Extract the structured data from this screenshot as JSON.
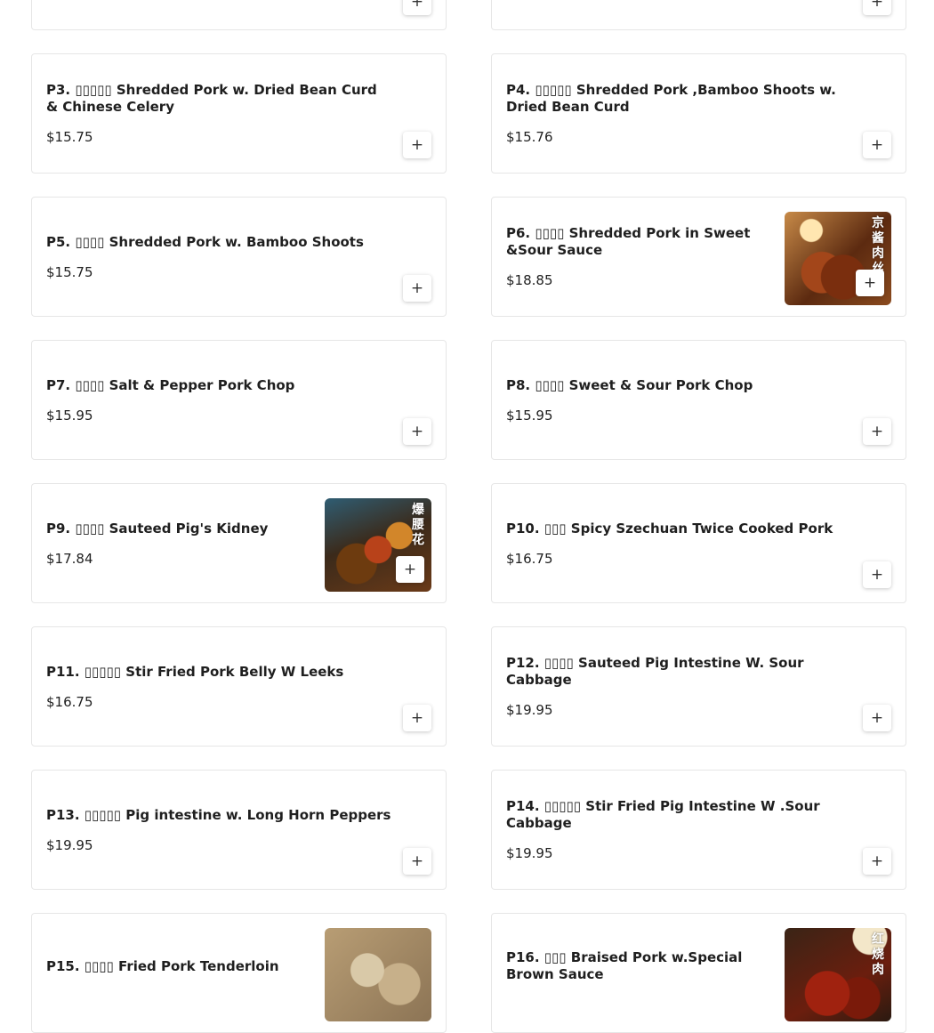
{
  "add_label": "+",
  "items": [
    {
      "name": "",
      "price": ""
    },
    {
      "name": "",
      "price": ""
    },
    {
      "name": "P3. ▯▯▯▯▯ Shredded Pork w. Dried Bean Curd & Chinese Celery",
      "price": "$15.75"
    },
    {
      "name": "P4. ▯▯▯▯▯ Shredded Pork ,Bamboo Shoots w. Dried Bean Curd",
      "price": "$15.76"
    },
    {
      "name": "P5. ▯▯▯▯ Shredded Pork w. Bamboo Shoots",
      "price": "$15.75"
    },
    {
      "name": "P6. ▯▯▯▯ Shredded Pork in Sweet &Sour Sauce",
      "price": "$18.85",
      "image_text": "京酱肉丝"
    },
    {
      "name": "P7. ▯▯▯▯ Salt & Pepper Pork Chop",
      "price": "$15.95"
    },
    {
      "name": "P8. ▯▯▯▯ Sweet & Sour Pork Chop",
      "price": "$15.95"
    },
    {
      "name": "P9. ▯▯▯▯ Sauteed Pig's Kidney",
      "price": "$17.84",
      "image_text": "爆腰花"
    },
    {
      "name": "P10. ▯▯▯ Spicy Szechuan Twice Cooked Pork",
      "price": "$16.75"
    },
    {
      "name": "P11. ▯▯▯▯▯ Stir Fried Pork Belly W Leeks",
      "price": "$16.75"
    },
    {
      "name": "P12. ▯▯▯▯ Sauteed Pig Intestine W. Sour Cabbage",
      "price": "$19.95"
    },
    {
      "name": "P13. ▯▯▯▯▯ Pig intestine w. Long Horn Peppers",
      "price": "$19.95"
    },
    {
      "name": "P14. ▯▯▯▯▯ Stir Fried Pig Intestine W .Sour Cabbage",
      "price": "$19.95"
    },
    {
      "name": "P15. ▯▯▯▯ Fried Pork Tenderloin",
      "price": ""
    },
    {
      "name": "P16. ▯▯▯ Braised Pork w.Special Brown Sauce",
      "price": "",
      "image_text": "红烧肉"
    }
  ]
}
